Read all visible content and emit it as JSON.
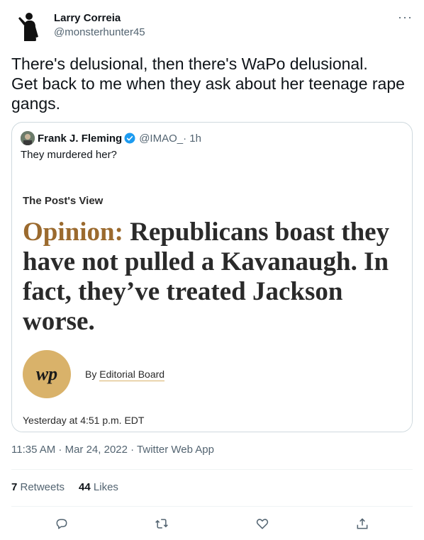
{
  "author": {
    "display_name": "Larry Correia",
    "handle": "@monsterhunter45",
    "avatar_icon": "silhouette-avatar"
  },
  "more_label": "···",
  "tweet_text": "There's delusional, then there's WaPo delusional.\nGet back to me when they ask about her teenage rape gangs.",
  "quoted": {
    "display_name": "Frank J. Fleming",
    "handle": "@IMAO_",
    "time": " · 1h",
    "text": "They murdered her?",
    "image": {
      "kicker": "The Post's View",
      "headline_prefix": "Opinion:",
      "headline": " Republicans boast they have not pulled a Kavanaugh. In fact, they’ve treated Jackson worse.",
      "logo_text": "wp",
      "byline_prefix": "By ",
      "byline_author": "Editorial Board",
      "posted": "Yesterday at 4:51 p.m. EDT"
    }
  },
  "meta": "11:35 AM · Mar 24, 2022 · Twitter Web App",
  "stats": {
    "retweets_count": "7",
    "retweets_label": " Retweets",
    "likes_count": "44",
    "likes_label": " Likes"
  },
  "colors": {
    "text": "#0f1419",
    "secondary": "#536471",
    "border": "#cfd9de",
    "verified": "#1d9bf0",
    "wapo_gold": "#d9b26a"
  }
}
